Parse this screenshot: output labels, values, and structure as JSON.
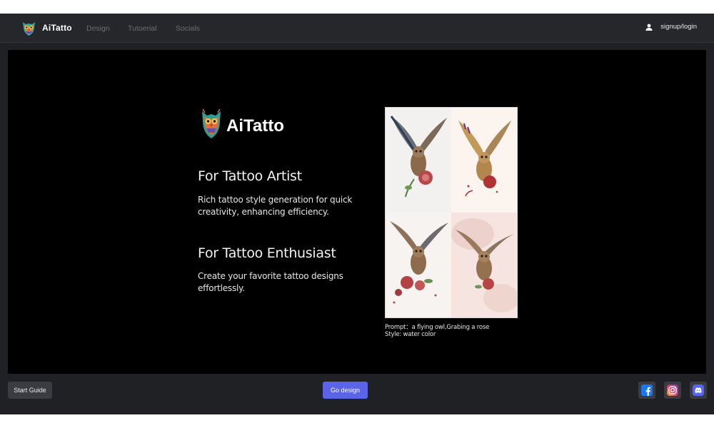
{
  "header": {
    "brand": "AiTatto",
    "nav": [
      "Design",
      "Tutoerial",
      "Socials"
    ],
    "login_label": "signup/login"
  },
  "hero": {
    "brand": "AiTatto",
    "sections": [
      {
        "title": "For Tattoo Artist",
        "text": "Rich tattoo style generation for quick creativity, enhancing efficiency."
      },
      {
        "title": "For Tattoo Enthusiast",
        "text": "Create your favorite tattoo designs effortlessly."
      }
    ]
  },
  "gallery": {
    "prompt_caption": "Prompt：a flying owl,Grabing a rose",
    "style_caption": "Style: water color"
  },
  "footer": {
    "start_guide_label": "Start Guide",
    "go_design_label": "Go design",
    "socials": [
      "facebook-icon",
      "instagram-icon",
      "discord-icon"
    ]
  },
  "colors": {
    "app_bg": "#202124",
    "stage_bg": "#000000",
    "primary_button": "#5b63e6"
  }
}
